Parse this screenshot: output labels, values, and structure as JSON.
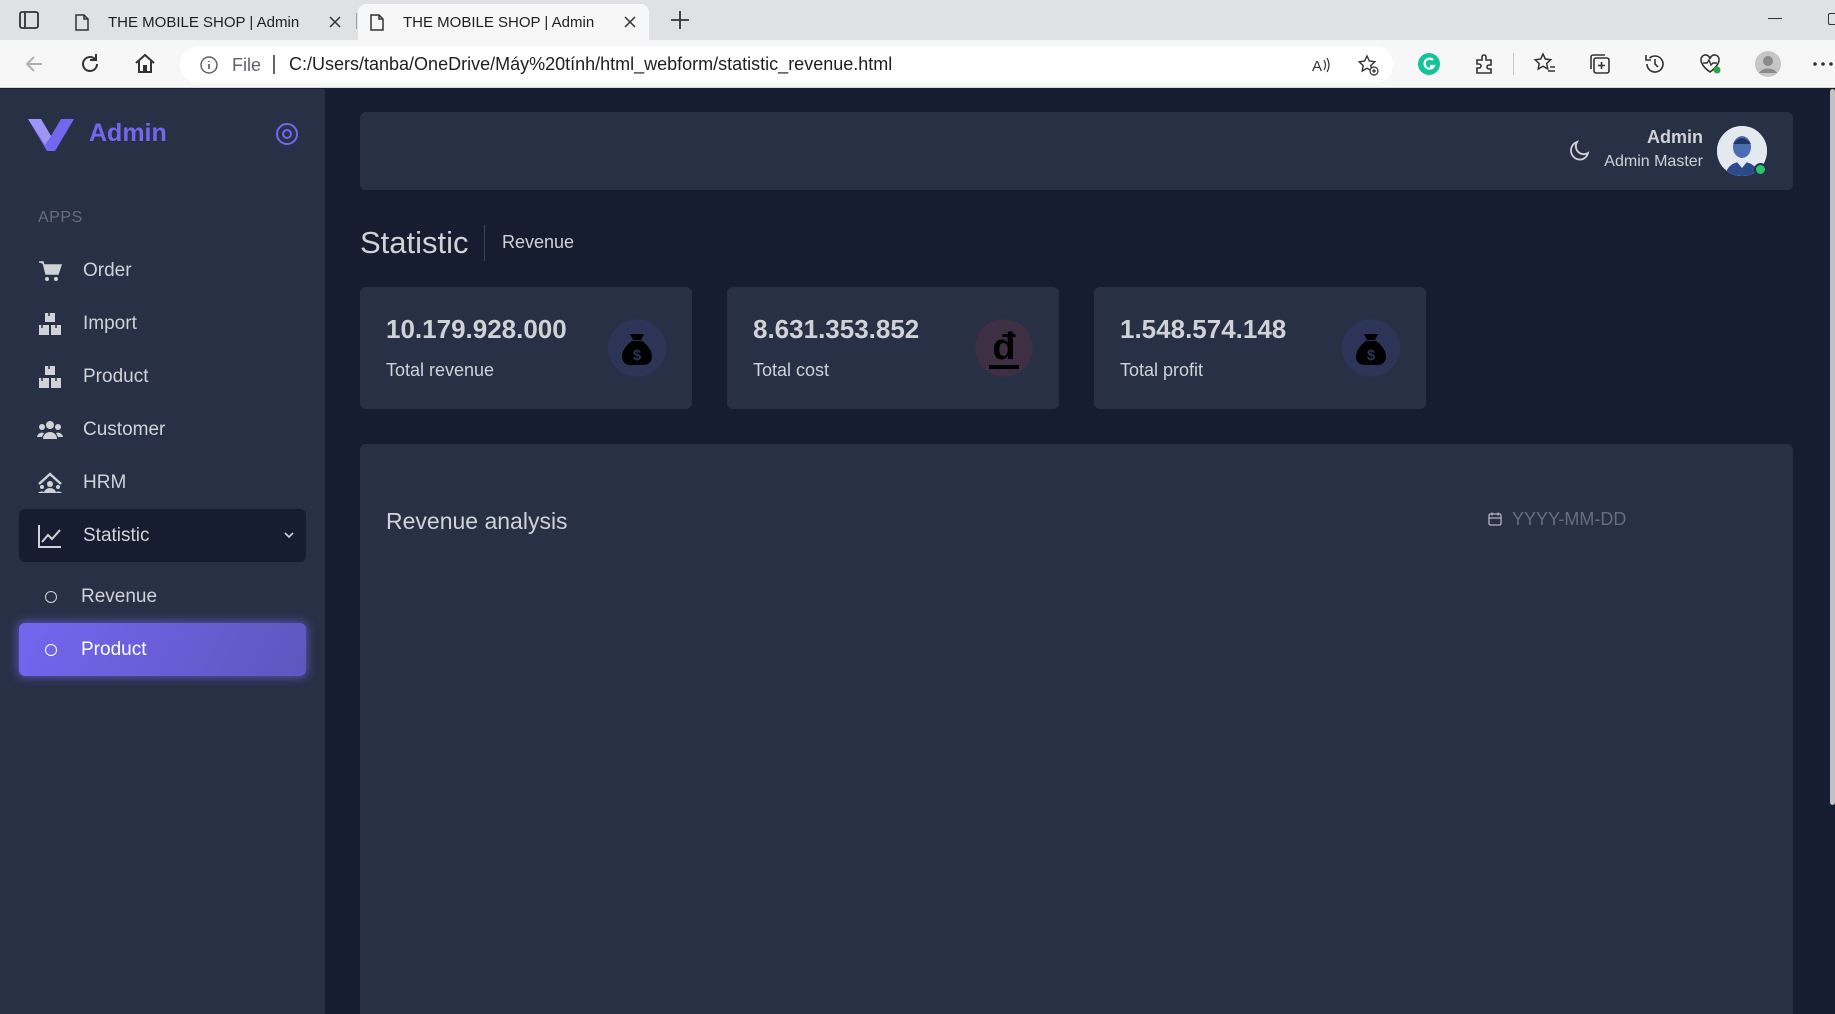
{
  "browser": {
    "tabs": [
      {
        "title": "THE MOBILE SHOP | Admin",
        "active": false
      },
      {
        "title": "THE MOBILE SHOP | Admin",
        "active": true
      }
    ],
    "address": {
      "scheme_label": "File",
      "url": "C:/Users/tanba/OneDrive/Máy%20tính/html_webform/statistic_revenue.html"
    }
  },
  "sidebar": {
    "brand": "Admin",
    "section_label": "APPS",
    "items": [
      {
        "label": "Order",
        "icon": "cart-icon"
      },
      {
        "label": "Import",
        "icon": "boxes-icon"
      },
      {
        "label": "Product",
        "icon": "boxes-icon"
      },
      {
        "label": "Customer",
        "icon": "users-icon"
      },
      {
        "label": "HRM",
        "icon": "hrm-icon"
      },
      {
        "label": "Statistic",
        "icon": "chart-line-icon",
        "expanded": true
      }
    ],
    "sub_items": [
      {
        "label": "Revenue"
      },
      {
        "label": "Product",
        "selected": true
      }
    ]
  },
  "header": {
    "user_name": "Admin",
    "user_role": "Admin Master"
  },
  "page": {
    "title": "Statistic",
    "breadcrumb": "Revenue"
  },
  "stats": [
    {
      "value": "10.179.928.000",
      "label": "Total revenue",
      "icon": "money-bag-icon"
    },
    {
      "value": "8.631.353.852",
      "label": "Total cost",
      "icon": "dong-icon"
    },
    {
      "value": "1.548.574.148",
      "label": "Total profit",
      "icon": "money-bag-icon"
    }
  ],
  "analysis": {
    "title": "Revenue analysis",
    "date_placeholder": "YYYY-MM-DD"
  },
  "colors": {
    "primary": "#7367f0",
    "body_bg": "#161d31",
    "card_bg": "#283046",
    "text": "#d0d2d6",
    "online": "#28c76f"
  }
}
